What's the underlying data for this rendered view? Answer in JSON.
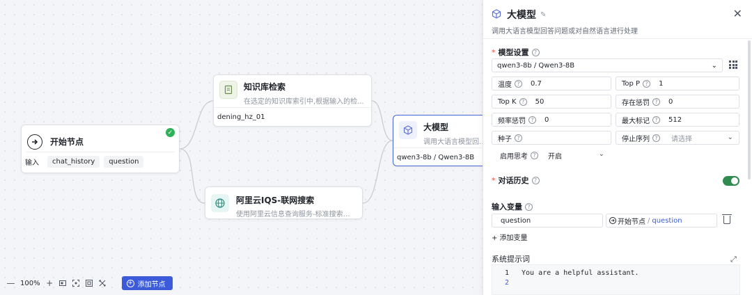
{
  "canvas": {
    "start_node": {
      "title": "开始节点",
      "input_label": "输入",
      "inputs": [
        "chat_history",
        "question"
      ]
    },
    "kb_node": {
      "title": "知识库检索",
      "desc": "在选定的知识库索引中,根据输入的检...",
      "sub": "dening_hz_01"
    },
    "llm_node": {
      "title": "大模型",
      "desc": "调用大语言模型回答问题或对自然语言进行处理",
      "sub": "qwen3-8b / Qwen3-8B"
    },
    "search_node": {
      "title": "阿里云IQS-联网搜索",
      "desc": "使用阿里云信息查询服务-标准搜索对..."
    }
  },
  "toolbar": {
    "zoom": "100%",
    "add_node": "添加节点"
  },
  "panel": {
    "title": "大模型",
    "desc": "调用大语言模型回答问题或对自然语言进行处理",
    "model_settings_label": "模型设置",
    "model_value": "qwen3-8b / Qwen3-8B",
    "params": {
      "temperature_label": "温度",
      "temperature": "0.7",
      "top_p_label": "Top P",
      "top_p": "1",
      "top_k_label": "Top K",
      "top_k": "50",
      "presence_label": "存在惩罚",
      "presence": "0",
      "frequency_label": "频率惩罚",
      "frequency": "0",
      "max_tokens_label": "最大标记",
      "max_tokens": "512",
      "seed_label": "种子",
      "stop_label": "停止序列",
      "stop_placeholder": "请选择",
      "thinking_label": "启用思考",
      "thinking_value": "开启"
    },
    "history_label": "对话历史",
    "history_enabled": true,
    "input_vars_label": "输入变量",
    "input_var": {
      "name": "question",
      "ref_node": "开始节点",
      "ref_var": "question"
    },
    "add_var": "+ 添加变量",
    "system_prompt_label": "系统提示词",
    "system_prompt_lines": [
      "You are a helpful assistant.",
      ""
    ]
  },
  "colors": {
    "accent": "#3b5bdb",
    "success": "#2fb15a",
    "toggle_on": "#2f8b4f",
    "required": "#e64a3b",
    "highlight_box": "#e23b3b"
  }
}
